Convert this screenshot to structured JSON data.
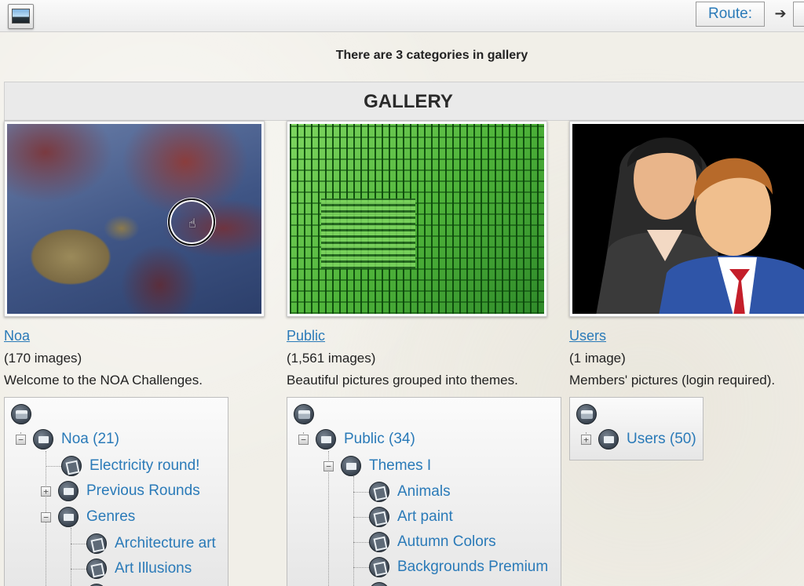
{
  "topbar": {
    "route_label": "Route:",
    "route_arrow": "➔"
  },
  "summary": "There are 3 categories in gallery",
  "gallery_title": "GALLERY",
  "categories": [
    {
      "title": "Noa",
      "count": "(170 images)",
      "description": "Welcome to the NOA Challenges.",
      "tree": [
        {
          "label": "Noa (21)"
        },
        {
          "label": "Electricity round!"
        },
        {
          "label": "Previous Rounds"
        },
        {
          "label": "Genres"
        },
        {
          "label": "Architecture art"
        },
        {
          "label": "Art Illusions"
        }
      ]
    },
    {
      "title": "Public",
      "count": "(1,561 images)",
      "description": "Beautiful pictures grouped into themes.",
      "tree": [
        {
          "label": "Public (34)"
        },
        {
          "label": "Themes I"
        },
        {
          "label": "Animals"
        },
        {
          "label": "Art paint"
        },
        {
          "label": "Autumn Colors"
        },
        {
          "label": "Backgrounds Premium"
        }
      ]
    },
    {
      "title": "Users",
      "count": "(1 image)",
      "description": "Members' pictures (login required).",
      "tree": [
        {
          "label": "Users (50)"
        }
      ]
    }
  ],
  "colors": {
    "link": "#2a7ab8",
    "background": "#f1efe8"
  }
}
